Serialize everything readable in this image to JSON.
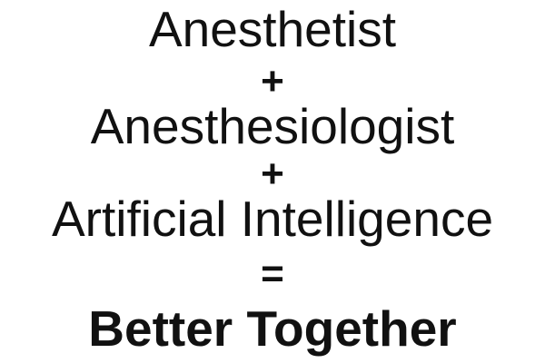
{
  "equation": {
    "term1": "Anesthetist",
    "operator1": "+",
    "term2": "Anesthesiologist",
    "operator2": "+",
    "term3": "Artificial Intelligence",
    "equals": "=",
    "result": "Better Together"
  },
  "colors": {
    "text": "#111111",
    "background": "#ffffff"
  }
}
